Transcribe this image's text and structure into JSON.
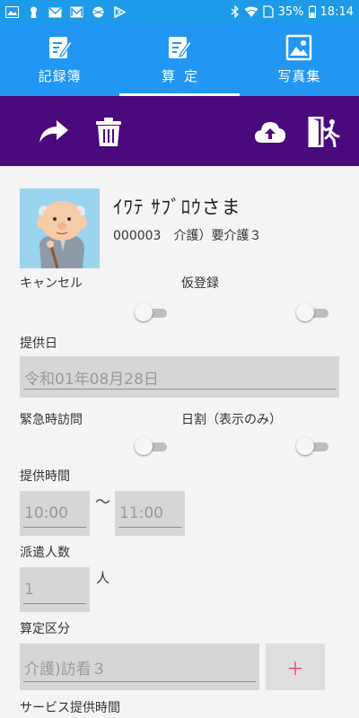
{
  "status_bar": {
    "battery": "35%",
    "time": "18:14",
    "left_icons": [
      "image-icon",
      "keyhole-icon",
      "mail-icon",
      "mail-icon",
      "ball-icon",
      "play-store-icon"
    ],
    "right_icons": [
      "bluetooth-icon",
      "wifi-icon",
      "sim-icon",
      "battery-icon"
    ]
  },
  "tabs": [
    {
      "label": "記録簿",
      "icon": "edit-note-icon",
      "active": false
    },
    {
      "label": "算定",
      "icon": "edit-note-icon",
      "active": true
    },
    {
      "label": "写真集",
      "icon": "photo-icon",
      "active": false
    }
  ],
  "actions": {
    "left": [
      "share-arrow-icon",
      "trash-icon"
    ],
    "right": [
      "cloud-upload-icon",
      "exit-door-icon"
    ]
  },
  "patient": {
    "name": "ｲﾜﾃ ｻﾌﾞﾛｳさま",
    "id": "000003",
    "care_level": "介護）要介護３"
  },
  "form": {
    "cancel_label": "キャンセル",
    "cancel_on": false,
    "provisional_label": "仮登録",
    "provisional_on": false,
    "service_date_label": "提供日",
    "service_date_value": "令和01年08月28日",
    "urgent_visit_label": "緊急時訪問",
    "urgent_visit_on": false,
    "daily_rate_label": "日割（表示のみ）",
    "daily_rate_on": false,
    "service_time_label": "提供時間",
    "start_time": "10:00",
    "time_separator": "～",
    "end_time": "11:00",
    "dispatch_label": "派遣人数",
    "dispatch_value": "1",
    "dispatch_unit": "人",
    "category_label": "算定区分",
    "category_value": "介護)訪看３",
    "add_label": "＋",
    "service_duration_label": "サービス提供時間"
  },
  "colors": {
    "status_bar": "#1e9be8",
    "tab_bar": "#2196f3",
    "action_bar": "#4a0a7e",
    "accent_plus": "#e0457a"
  }
}
